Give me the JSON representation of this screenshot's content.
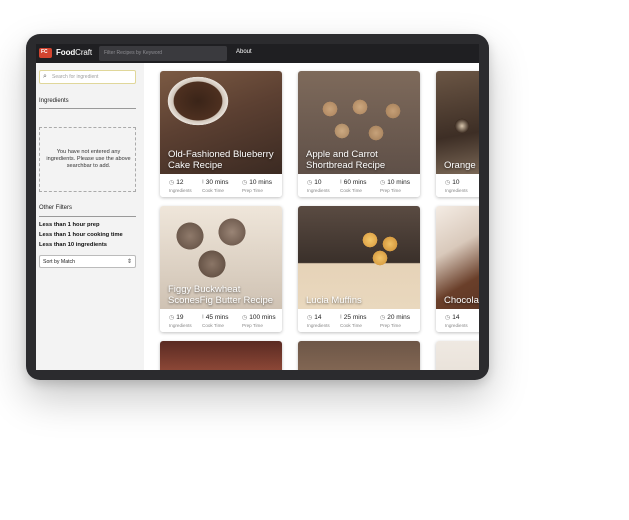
{
  "nav": {
    "logo_badge": "FC",
    "brand_bold": "Food",
    "brand_rest": "Craft",
    "search_placeholder": "Filter Recipes by Keyword",
    "about_label": "About"
  },
  "sidebar": {
    "ingredient_search_placeholder": "Search for ingredient",
    "ingredients_heading": "Ingredients",
    "empty_message": "You have not entered any ingredients. Please use the above searchbar to add.",
    "other_filters_heading": "Other Filters",
    "filters": [
      "Less than 1 hour prep",
      "Less than 1 hour cooking time",
      "Less than 10 ingredients"
    ],
    "sort_value": "Sort by Match"
  },
  "labels": {
    "ingredients": "Ingredients",
    "cook": "Cook Time",
    "prep": "Prep Time"
  },
  "recipes": [
    {
      "title": "Old-Fashioned Blueberry Cake Recipe",
      "ingredients": "12",
      "cook": "30 mins",
      "prep": "10 mins"
    },
    {
      "title": "Apple and Carrot Shortbread Recipe",
      "ingredients": "10",
      "cook": "60 mins",
      "prep": "10 mins"
    },
    {
      "title": "Orange ... Recipe",
      "ingredients": "10",
      "cook": "",
      "prep": ""
    },
    {
      "title": "Figgy Buckwheat SconesFig Butter Recipe",
      "ingredients": "19",
      "cook": "45 mins",
      "prep": "100 mins"
    },
    {
      "title": "Lucia Muffins",
      "ingredients": "14",
      "cook": "25 mins",
      "prep": "20 mins"
    },
    {
      "title": "Chocola... Brownie...",
      "ingredients": "14",
      "cook": "",
      "prep": ""
    }
  ],
  "colors": {
    "navbar": "#1f1f22",
    "device": "#2b2b2e",
    "logo": "#d3442f",
    "sidebar": "#f3f3f3"
  }
}
